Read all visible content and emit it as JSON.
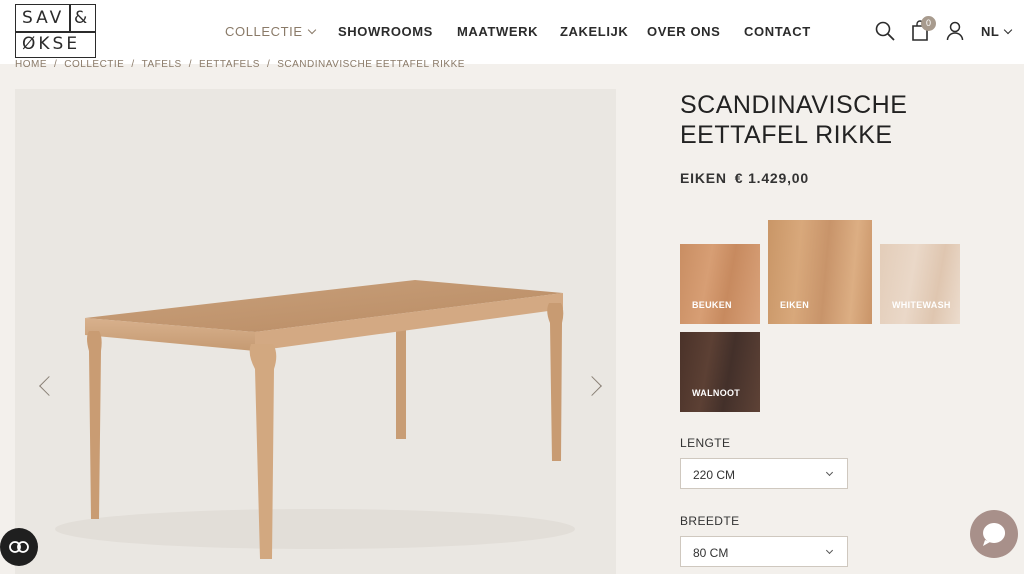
{
  "brand": {
    "logo_row1_left": "SAV",
    "logo_row1_right": "&",
    "logo_row2": "ØKSE"
  },
  "nav": {
    "items": [
      {
        "label": "COLLECTIE",
        "active": true,
        "has_dropdown": true
      },
      {
        "label": "SHOWROOMS"
      },
      {
        "label": "MAATWERK"
      },
      {
        "label": "ZAKELIJK"
      },
      {
        "label": "OVER ONS"
      },
      {
        "label": "CONTACT"
      }
    ]
  },
  "header": {
    "icons": [
      "search-icon",
      "cart-icon",
      "user-icon"
    ],
    "cart_count": "0",
    "language": "NL"
  },
  "breadcrumb": [
    "HOME",
    "COLLECTIE",
    "TAFELS",
    "EETTAFELS",
    "SCANDINAVISCHE EETTAFEL RIKKE"
  ],
  "product": {
    "title_line1": "SCANDINAVISCHE",
    "title_line2": "EETTAFEL RIKKE",
    "variant": "EIKEN",
    "price": "€ 1.429,00",
    "swatches": [
      {
        "label": "BEUKEN",
        "color": "#d19a70"
      },
      {
        "label": "EIKEN",
        "color": "#d3a275",
        "selected": true
      },
      {
        "label": "WHITEWASH",
        "color": "#e6d3c2"
      },
      {
        "label": "WALNOOT",
        "color": "#52382e"
      }
    ],
    "options": [
      {
        "label": "LENGTE",
        "value": "220 CM"
      },
      {
        "label": "BREEDTE",
        "value": "80 CM"
      }
    ]
  },
  "colors": {
    "accent": "#8a7a68",
    "background": "#f3f0ec",
    "chat": "#a8908a"
  }
}
